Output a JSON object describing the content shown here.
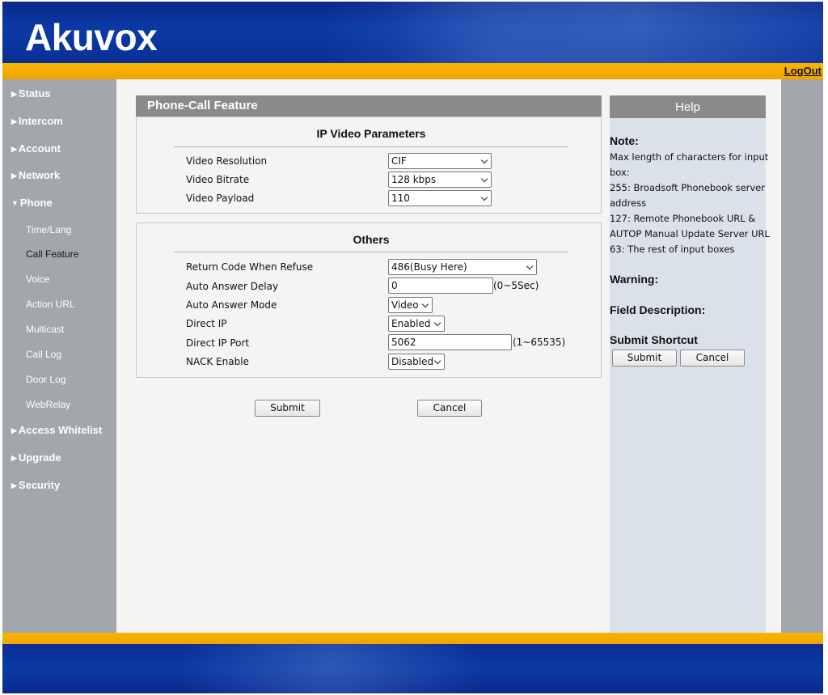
{
  "brand": {
    "logo_text": "Akuvox"
  },
  "header": {
    "logout_label": "LogOut"
  },
  "sidebar": {
    "items": [
      {
        "label": "Status",
        "expanded": false
      },
      {
        "label": "Intercom",
        "expanded": false
      },
      {
        "label": "Account",
        "expanded": false
      },
      {
        "label": "Network",
        "expanded": false
      },
      {
        "label": "Phone",
        "expanded": true
      },
      {
        "label": "Access Whitelist",
        "expanded": false
      },
      {
        "label": "Upgrade",
        "expanded": false
      },
      {
        "label": "Security",
        "expanded": false
      }
    ],
    "phone_subitems": [
      {
        "label": "Time/Lang"
      },
      {
        "label": "Call Feature",
        "active": true
      },
      {
        "label": "Voice"
      },
      {
        "label": "Action URL"
      },
      {
        "label": "Multicast"
      },
      {
        "label": "Call Log"
      },
      {
        "label": "Door Log"
      },
      {
        "label": "WebRelay"
      }
    ]
  },
  "main": {
    "panel_title": "Phone-Call Feature",
    "video_section": {
      "title": "IP Video Parameters",
      "rows": [
        {
          "label": "Video Resolution",
          "value": "CIF"
        },
        {
          "label": "Video Bitrate",
          "value": "128 kbps"
        },
        {
          "label": "Video Payload",
          "value": "110"
        }
      ]
    },
    "others_section": {
      "title": "Others",
      "rows": [
        {
          "label": "Return Code When Refuse",
          "value": "486(Busy Here)"
        },
        {
          "label": "Auto Answer Delay",
          "value": "0",
          "hint": "(0~5Sec)"
        },
        {
          "label": "Auto Answer Mode",
          "value": "Video"
        },
        {
          "label": "Direct IP",
          "value": "Enabled"
        },
        {
          "label": "Direct IP Port",
          "value": "5062",
          "hint": "(1~65535)"
        },
        {
          "label": "NACK Enable",
          "value": "Disabled"
        }
      ]
    },
    "submit_label": "Submit",
    "cancel_label": "Cancel"
  },
  "help": {
    "title": "Help",
    "note_title": "Note:",
    "note_lines": [
      "Max length of characters for input",
      "box:",
      "255: Broadsoft Phonebook server",
      "address",
      "127: Remote Phonebook URL &",
      "AUTOP Manual Update Server URL",
      "63: The rest of input boxes"
    ],
    "warning_title": "Warning:",
    "field_desc_title": "Field Description:",
    "shortcut_title": "Submit Shortcut",
    "submit_label": "Submit",
    "cancel_label": "Cancel"
  },
  "colors": {
    "header_blue": "#0b3aa6",
    "accent_gold": "#f7b600",
    "sidebar_gray": "#a3a6ab",
    "panel_header_gray": "#8a8a8a",
    "help_bg": "#dbe1ea"
  }
}
